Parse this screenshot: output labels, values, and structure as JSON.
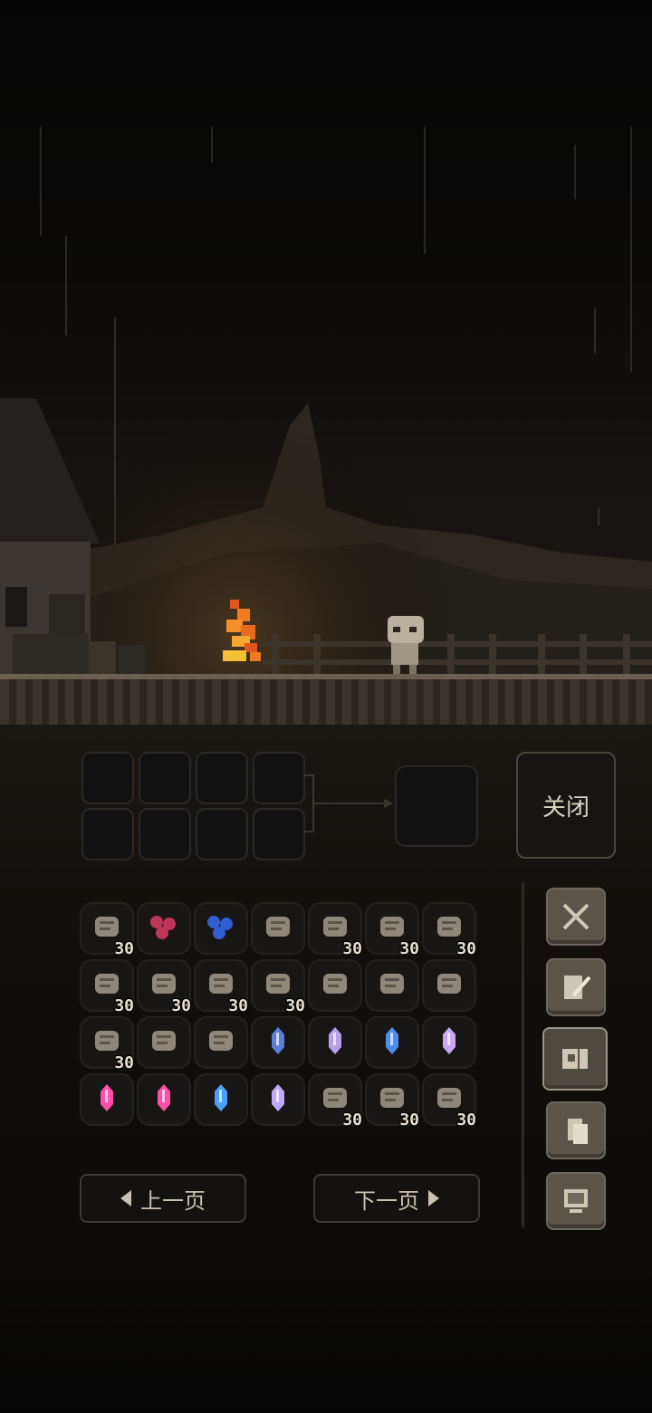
{
  "crafting": {
    "close_label": "关闭"
  },
  "inventory": {
    "rows": [
      [
        {
          "icon": "pretzel-icon",
          "count": "30",
          "color": "#8f887a"
        },
        {
          "icon": "red-berries-icon",
          "count": "",
          "color": "#c0365a"
        },
        {
          "icon": "blue-berries-icon",
          "count": "",
          "color": "#2f5fd0"
        },
        {
          "icon": "bread-loaf-icon",
          "count": "",
          "color": "#8f887a"
        },
        {
          "icon": "jar-icon",
          "count": "30",
          "color": "#8f887a"
        },
        {
          "icon": "bottle-icon",
          "count": "30",
          "color": "#8f887a"
        },
        {
          "icon": "pie-icon",
          "count": "30",
          "color": "#8f887a"
        }
      ],
      [
        {
          "icon": "wheat-bundle-icon",
          "count": "30",
          "color": "#8f887a"
        },
        {
          "icon": "beer-mug-icon",
          "count": "30",
          "color": "#8f887a"
        },
        {
          "icon": "stew-bowl-icon",
          "count": "30",
          "color": "#8f887a"
        },
        {
          "icon": "potion-flask-icon",
          "count": "30",
          "color": "#8f887a"
        },
        {
          "icon": "scroll-icon",
          "count": "",
          "color": "#8f887a"
        },
        {
          "icon": "scroll-icon",
          "count": "",
          "color": "#8f887a"
        },
        {
          "icon": "scroll-icon",
          "count": "",
          "color": "#8f887a"
        }
      ],
      [
        {
          "icon": "spiky-ball-icon",
          "count": "30",
          "color": "#8f887a"
        },
        {
          "icon": "hourglass-icon",
          "count": "",
          "color": "#8f887a"
        },
        {
          "icon": "scroll-icon",
          "count": "",
          "color": "#8f887a"
        },
        {
          "icon": "blue-crystal-icon",
          "count": "",
          "color": "#5b7fd6"
        },
        {
          "icon": "violet-crystal-icon",
          "count": "",
          "color": "#b8a0e8"
        },
        {
          "icon": "blue-crystal-icon",
          "count": "",
          "color": "#4a8ef0"
        },
        {
          "icon": "violet-crystal-icon",
          "count": "",
          "color": "#c8a8f0"
        }
      ],
      [
        {
          "icon": "pink-crystal-icon",
          "count": "",
          "color": "#ff4fa8"
        },
        {
          "icon": "pink-crystal-icon",
          "count": "",
          "color": "#ff4fa8"
        },
        {
          "icon": "blue-crystal-icon",
          "count": "",
          "color": "#4aa0ff"
        },
        {
          "icon": "violet-crystal-icon",
          "count": "",
          "color": "#c0a8ff"
        },
        {
          "icon": "quill-book-icon",
          "count": "30",
          "color": "#8f887a"
        },
        {
          "icon": "plank-icon",
          "count": "30",
          "color": "#8f887a"
        },
        {
          "icon": "stone-icon",
          "count": "30",
          "color": "#8f887a"
        }
      ]
    ]
  },
  "pagination": {
    "prev_label": "上一页",
    "next_label": "下一页"
  },
  "sidebar": {
    "buttons": [
      {
        "name": "crossed-swords-icon"
      },
      {
        "name": "quill-paper-icon"
      },
      {
        "name": "map-icon"
      },
      {
        "name": "documents-icon"
      },
      {
        "name": "computer-icon"
      }
    ],
    "active_index": 2
  }
}
